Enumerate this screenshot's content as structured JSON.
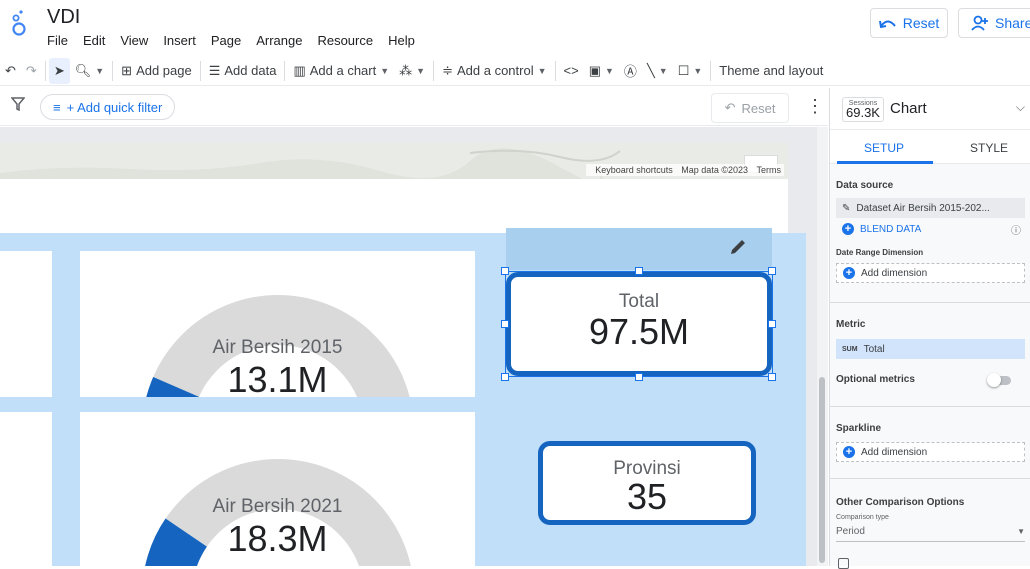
{
  "app": {
    "title": "VDI",
    "menus": [
      "File",
      "Edit",
      "View",
      "Insert",
      "Page",
      "Arrange",
      "Resource",
      "Help"
    ],
    "reset_label": "Reset",
    "share_label": "Share"
  },
  "toolbar": {
    "add_page": "Add page",
    "add_data": "Add data",
    "add_chart": "Add a chart",
    "add_control": "Add a control",
    "theme": "Theme and layout"
  },
  "filterbar": {
    "quick_filter": "+ Add quick filter",
    "reset_label": "Reset"
  },
  "map": {
    "shortcuts": "Keyboard shortcuts",
    "map_data": "Map data ©2023",
    "terms": "Terms"
  },
  "gauges": [
    {
      "label": "Air Bersih 2015",
      "value": "13.1M",
      "fill": 0.13
    },
    {
      "label": "Air Bersih 2021",
      "value": "18.3M",
      "fill": 0.19
    }
  ],
  "scorecards": [
    {
      "label": "Total",
      "value": "97.5M"
    },
    {
      "label": "Provinsi",
      "value": "35"
    }
  ],
  "panel": {
    "chip_label": "Sessions",
    "chip_value": "69.3K",
    "title": "Chart",
    "tab_setup": "SETUP",
    "tab_style": "STYLE",
    "data_source_title": "Data source",
    "data_source_value": "Dataset Air Bersih 2015-202...",
    "blend_data": "BLEND DATA",
    "date_range_title": "Date Range Dimension",
    "add_dimension": "Add dimension",
    "metric_title": "Metric",
    "metric_agg": "SUM",
    "metric_value": "Total",
    "optional_metrics": "Optional metrics",
    "sparkline_title": "Sparkline",
    "sparkline_add": "Add dimension",
    "other_comparison": "Other Comparison Options",
    "comparison_type": "Comparison type",
    "comparison_value": "Period"
  },
  "colors": {
    "accent": "#1a73e8",
    "gauge_fill": "#1565c0",
    "gauge_track": "#dadada",
    "canvas_bg": "#c2dffa"
  }
}
